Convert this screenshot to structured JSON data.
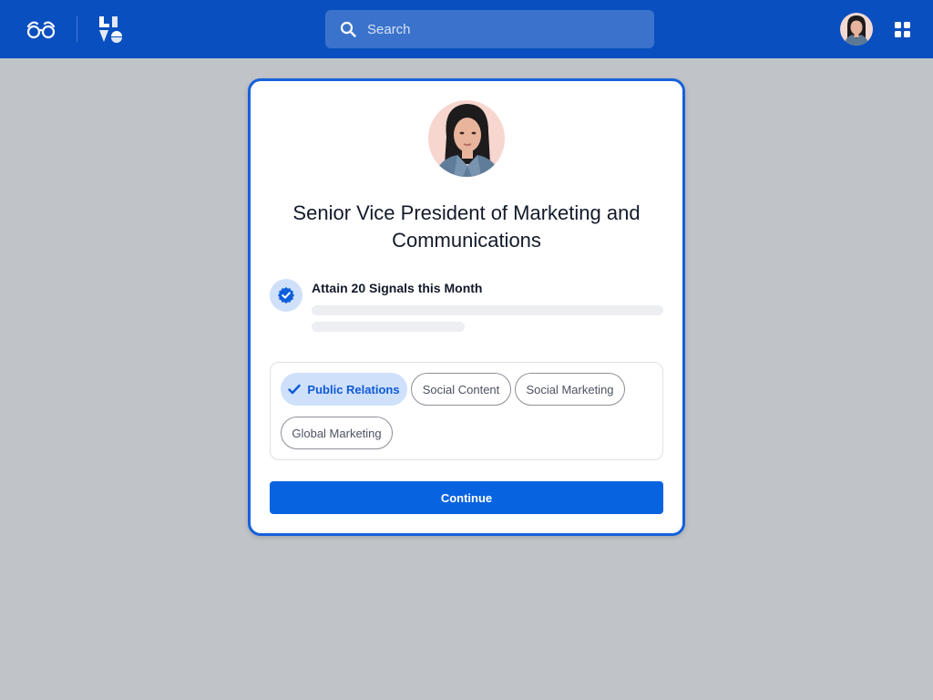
{
  "header": {
    "search": {
      "placeholder": "Search",
      "value": ""
    }
  },
  "card": {
    "title": "Senior Vice President of Marketing and Communications",
    "goal": {
      "title": "Attain 20 Signals this Month"
    },
    "tags": [
      {
        "label": "Public Relations",
        "selected": true
      },
      {
        "label": "Social Content",
        "selected": false
      },
      {
        "label": "Social Marketing",
        "selected": false
      },
      {
        "label": "Global Marketing",
        "selected": false
      }
    ],
    "continue_label": "Continue"
  },
  "colors": {
    "header_bg": "#0a4fbf",
    "accent": "#0863e0",
    "chip_selected_bg": "#cfe0fb",
    "page_bg": "#c0c4c8"
  },
  "icons": [
    "glasses-logo-icon",
    "brand-logo-icon",
    "search-icon",
    "apps-grid-icon",
    "verified-badge-icon",
    "check-icon"
  ]
}
